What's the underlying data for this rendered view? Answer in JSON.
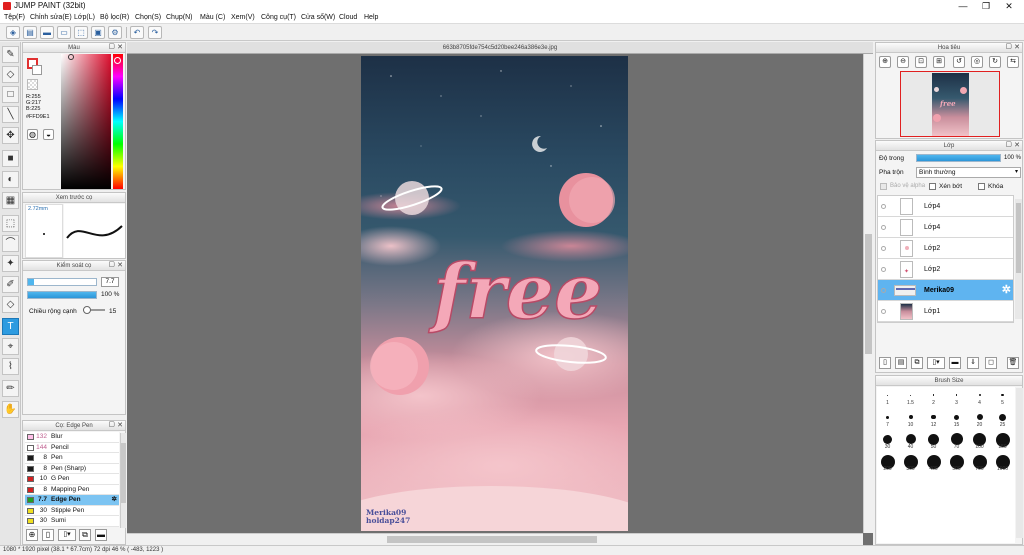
{
  "app": {
    "title": "JUMP PAINT (32bit)"
  },
  "window_controls": {
    "minimize": "—",
    "maximize": "❐",
    "close": "✕"
  },
  "menu": [
    "Tệp(F)",
    "Chỉnh sửa(E)",
    "Lớp(L)",
    "Bộ lọc(R)",
    "Chọn(S)",
    "Chụp(N)",
    "Màu (C)",
    "Xem(V)",
    "Công cụ(T)",
    "Cửa sổ(W)",
    "Cloud",
    "Help"
  ],
  "document": {
    "filename": "663b8705fde754c5d20bee246a386e3e.jpg"
  },
  "color_panel": {
    "title": "Màu",
    "r": "R:255",
    "g": "G:217",
    "b": "B:225",
    "hex": "#FFD9E1",
    "fg_color": "#ffd9e1"
  },
  "brush_preview": {
    "title": "Xem trước cọ",
    "size": "2.72mm"
  },
  "brush_control": {
    "title": "Kiểm soát cọ",
    "size_value": "7.7",
    "opacity_value": "100 %",
    "edge_label": "Chiều rộng cạnh",
    "edge_value": "15"
  },
  "brush_list": {
    "title": "Cọ: Edge Pen",
    "items": [
      {
        "size": "132",
        "name": "Blur",
        "color": "#ffc0e8"
      },
      {
        "size": "144",
        "name": "Pencil",
        "color": "#ffffff"
      },
      {
        "size": "8",
        "name": "Pen",
        "color": "#1a1a1a"
      },
      {
        "size": "8",
        "name": "Pen (Sharp)",
        "color": "#1a1a1a"
      },
      {
        "size": "10",
        "name": "G Pen",
        "color": "#d42020"
      },
      {
        "size": "8",
        "name": "Mapping Pen",
        "color": "#d42020"
      },
      {
        "size": "7.7",
        "name": "Edge Pen",
        "color": "#20a020",
        "selected": true
      },
      {
        "size": "30",
        "name": "Stipple Pen",
        "color": "#f0e020"
      },
      {
        "size": "30",
        "name": "Sumi",
        "color": "#f0e020"
      }
    ]
  },
  "navigator": {
    "title": "Hoa tiêu"
  },
  "layers_panel": {
    "title": "Lớp",
    "opacity_label": "Độ trong",
    "opacity_value": "100 %",
    "blend_label": "Pha trộn",
    "blend_value": "Bình thường",
    "protect_alpha": "Bảo vệ alpha",
    "clipping": "Xén bớt",
    "lock": "Khóa",
    "layers": [
      {
        "name": "Lớp4",
        "selected": false
      },
      {
        "name": "Lớp4",
        "selected": false
      },
      {
        "name": "Lớp2",
        "selected": false
      },
      {
        "name": "Lớp2",
        "selected": false
      },
      {
        "name": "Merika09",
        "selected": true
      },
      {
        "name": "Lớp1",
        "selected": false
      }
    ]
  },
  "brush_size_panel": {
    "title": "Brush Size",
    "sizes": [
      "1",
      "1.5",
      "2",
      "3",
      "4",
      "5",
      "7",
      "10",
      "12",
      "15",
      "20",
      "25",
      "30",
      "40",
      "50",
      "70",
      "100",
      "150",
      "200",
      "300",
      "400",
      "500",
      "700",
      "1000"
    ]
  },
  "canvas_text": {
    "free": "free",
    "watermark1": "Merika09",
    "watermark2": "holdap247"
  },
  "status": {
    "text": "1080 * 1920 pixel   (38.1 * 67.7cm)   72 dpi   46 %   ( -483, 1223 )"
  }
}
